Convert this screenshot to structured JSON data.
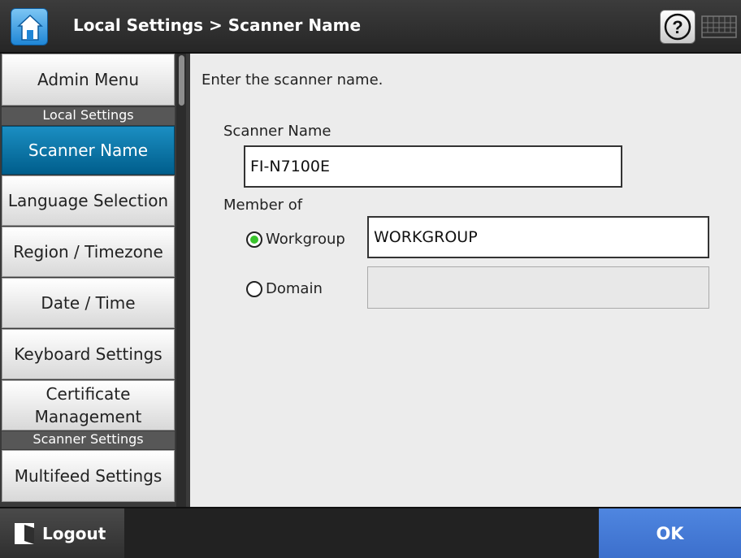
{
  "header": {
    "title": "Local Settings > Scanner Name"
  },
  "sidebar": {
    "items": [
      {
        "label": "Admin Menu"
      },
      {
        "section": "Local Settings"
      },
      {
        "label": "Scanner Name",
        "active": true
      },
      {
        "label": "Language Selection"
      },
      {
        "label": "Region / Timezone"
      },
      {
        "label": "Date / Time"
      },
      {
        "label": "Keyboard Settings"
      },
      {
        "label": "Certificate Management"
      },
      {
        "section": "Scanner Settings"
      },
      {
        "label": "Multifeed Settings"
      }
    ]
  },
  "main": {
    "instruction": "Enter the scanner name.",
    "scanner_name_label": "Scanner Name",
    "scanner_name_value": "FI-N7100E",
    "member_of_label": "Member of",
    "workgroup_label": "Workgroup",
    "workgroup_value": "WORKGROUP",
    "workgroup_selected": true,
    "domain_label": "Domain",
    "domain_value": ""
  },
  "footer": {
    "logout_label": "Logout",
    "ok_label": "OK"
  },
  "colors": {
    "active_item": "#0a7aae",
    "ok_button": "#4479d8",
    "radio_selected": "#39c42c"
  }
}
